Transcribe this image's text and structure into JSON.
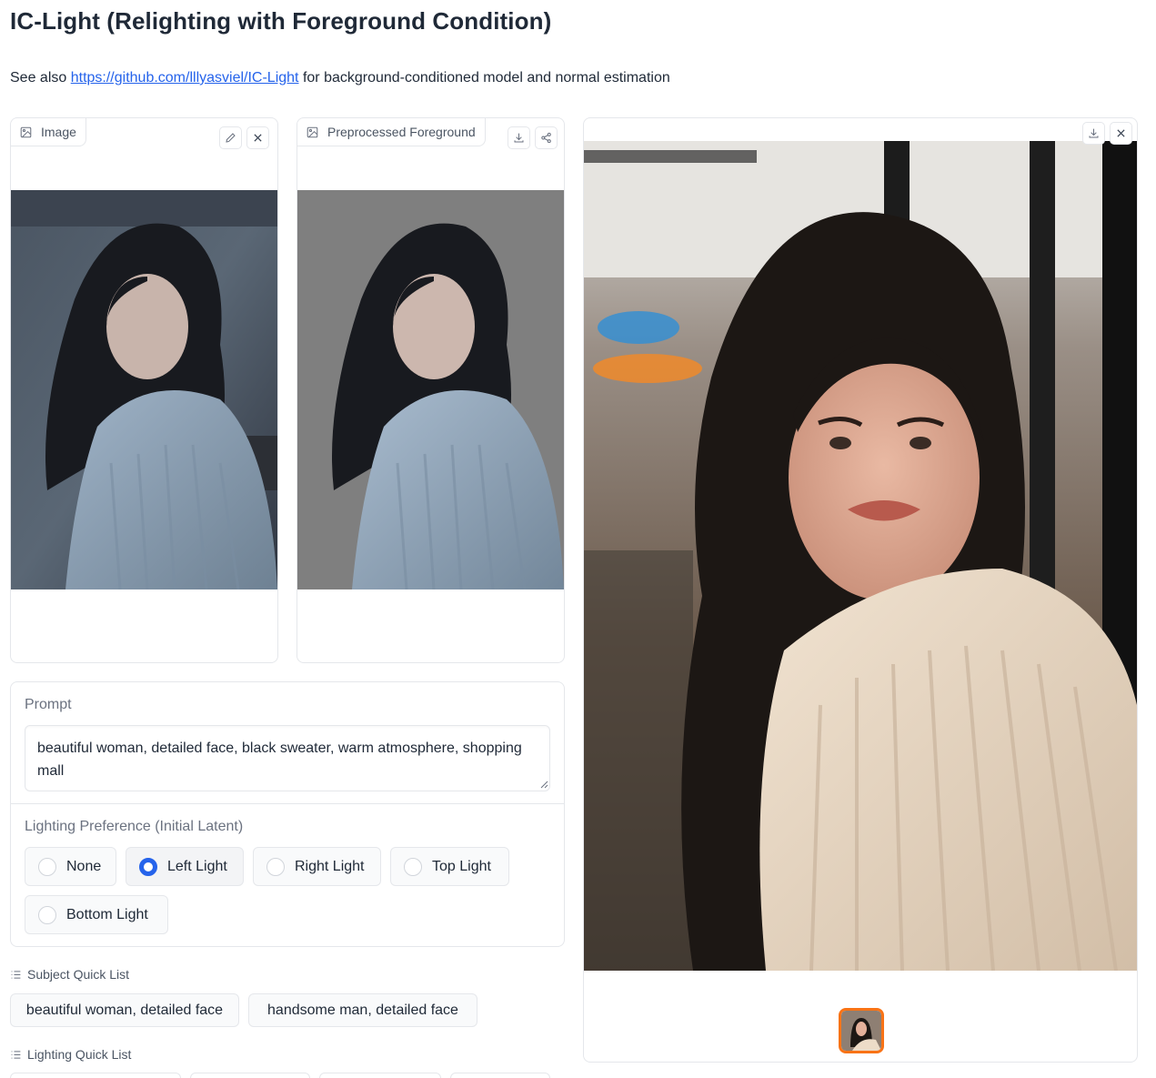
{
  "title": "IC-Light (Relighting with Foreground Condition)",
  "subtitle": {
    "prefix": "See also ",
    "link_text": "https://github.com/lllyasviel/IC-Light",
    "suffix": " for background-conditioned model and normal estimation"
  },
  "input_image": {
    "label": "Image",
    "icons": [
      "image-icon",
      "edit-icon",
      "close-icon"
    ]
  },
  "preprocessed": {
    "label": "Preprocessed Foreground",
    "icons": [
      "image-icon",
      "download-icon",
      "share-icon"
    ]
  },
  "output": {
    "icons": [
      "download-icon",
      "close-icon"
    ]
  },
  "prompt": {
    "label": "Prompt",
    "value": "beautiful woman, detailed face, black sweater, warm atmosphere, shopping mall"
  },
  "lighting_preference": {
    "label": "Lighting Preference (Initial Latent)",
    "options": [
      "None",
      "Left Light",
      "Right Light",
      "Top Light",
      "Bottom Light"
    ],
    "selected": "Left Light"
  },
  "subject_quick_list": {
    "label": "Subject Quick List",
    "items": [
      "beautiful woman, detailed face",
      "handsome man, detailed face"
    ]
  },
  "lighting_quick_list": {
    "label": "Lighting Quick List"
  },
  "colors": {
    "accent": "#2563eb",
    "thumbnail_border": "#f97316"
  }
}
